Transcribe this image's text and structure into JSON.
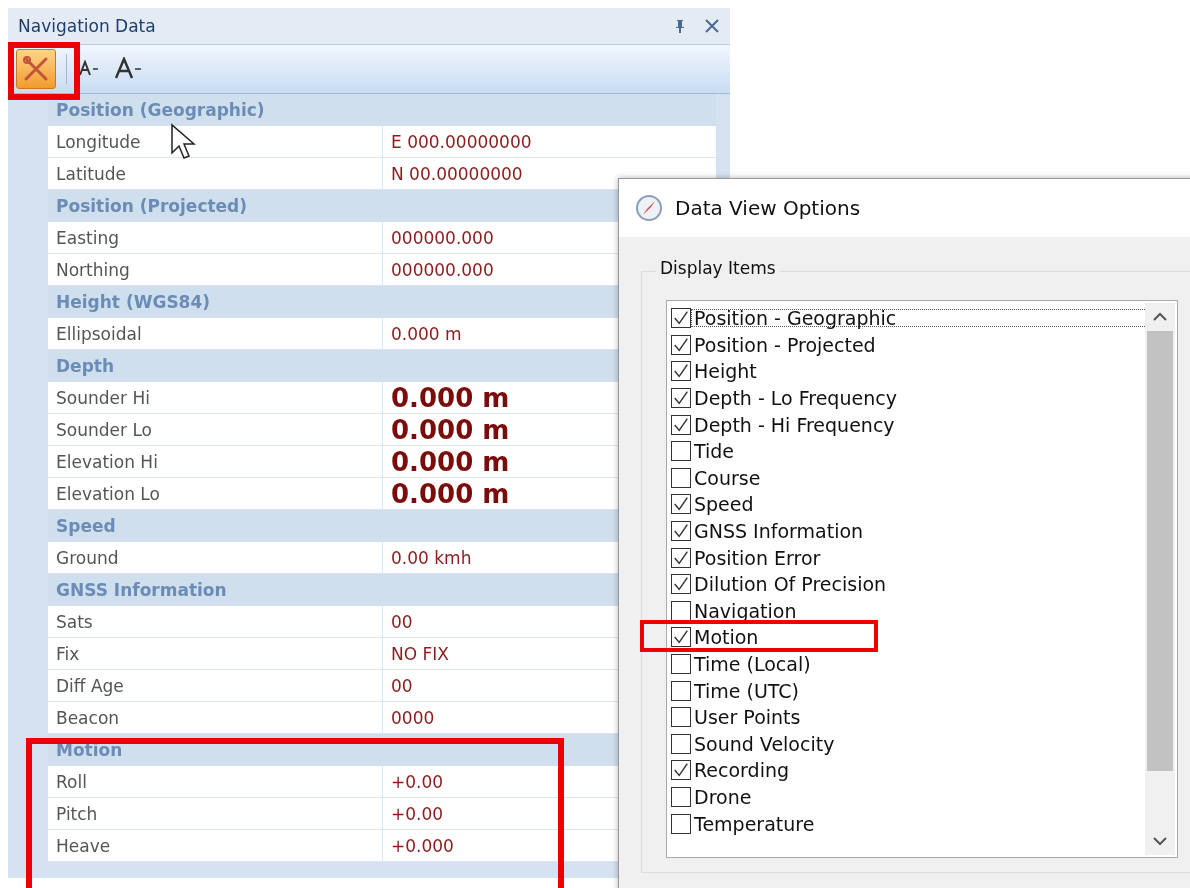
{
  "panel": {
    "title": "Navigation Data",
    "sections": [
      {
        "title": "Position (Geographic)",
        "rows": [
          {
            "label": "Longitude",
            "value": "E 000.00000000",
            "large": false
          },
          {
            "label": "Latitude",
            "value": "N 00.00000000",
            "large": false
          }
        ]
      },
      {
        "title": "Position (Projected)",
        "rows": [
          {
            "label": "Easting",
            "value": "000000.000",
            "large": false
          },
          {
            "label": "Northing",
            "value": "000000.000",
            "large": false
          }
        ]
      },
      {
        "title": "Height (WGS84)",
        "rows": [
          {
            "label": "Ellipsoidal",
            "value": "0.000 m",
            "large": false
          }
        ]
      },
      {
        "title": "Depth",
        "rows": [
          {
            "label": "Sounder Hi",
            "value": "0.000 m",
            "large": true
          },
          {
            "label": "Sounder Lo",
            "value": "0.000 m",
            "large": true
          },
          {
            "label": "Elevation Hi",
            "value": "0.000 m",
            "large": true
          },
          {
            "label": "Elevation Lo",
            "value": "0.000 m",
            "large": true
          }
        ]
      },
      {
        "title": "Speed",
        "rows": [
          {
            "label": "Ground",
            "value": "0.00 kmh",
            "large": false
          }
        ]
      },
      {
        "title": "GNSS Information",
        "rows": [
          {
            "label": "Sats",
            "value": "00",
            "large": false
          },
          {
            "label": "Fix",
            "value": "NO FIX",
            "large": false
          },
          {
            "label": "Diff Age",
            "value": "00",
            "large": false
          },
          {
            "label": "Beacon",
            "value": "0000",
            "large": false
          }
        ]
      },
      {
        "title": "Motion",
        "rows": [
          {
            "label": "Roll",
            "value": "+0.00",
            "large": false
          },
          {
            "label": "Pitch",
            "value": "+0.00",
            "large": false
          },
          {
            "label": "Heave",
            "value": "+0.000",
            "large": false
          }
        ]
      }
    ]
  },
  "dialog": {
    "title": "Data View Options",
    "group": "Display Items",
    "items": [
      {
        "label": "Position - Geographic",
        "checked": true,
        "focused": true
      },
      {
        "label": "Position - Projected",
        "checked": true,
        "focused": false
      },
      {
        "label": "Height",
        "checked": true,
        "focused": false
      },
      {
        "label": "Depth - Lo Frequency",
        "checked": true,
        "focused": false
      },
      {
        "label": "Depth - Hi Frequency",
        "checked": true,
        "focused": false
      },
      {
        "label": "Tide",
        "checked": false,
        "focused": false
      },
      {
        "label": "Course",
        "checked": false,
        "focused": false
      },
      {
        "label": "Speed",
        "checked": true,
        "focused": false
      },
      {
        "label": "GNSS Information",
        "checked": true,
        "focused": false
      },
      {
        "label": "Position Error",
        "checked": true,
        "focused": false
      },
      {
        "label": "Dilution Of Precision",
        "checked": true,
        "focused": false
      },
      {
        "label": "Navigation",
        "checked": false,
        "focused": false
      },
      {
        "label": "Motion",
        "checked": true,
        "focused": false
      },
      {
        "label": "Time (Local)",
        "checked": false,
        "focused": false
      },
      {
        "label": "Time (UTC)",
        "checked": false,
        "focused": false
      },
      {
        "label": "User Points",
        "checked": false,
        "focused": false
      },
      {
        "label": "Sound Velocity",
        "checked": false,
        "focused": false
      },
      {
        "label": "Recording",
        "checked": true,
        "focused": false
      },
      {
        "label": "Drone",
        "checked": false,
        "focused": false
      },
      {
        "label": "Temperature",
        "checked": false,
        "focused": false
      }
    ]
  }
}
